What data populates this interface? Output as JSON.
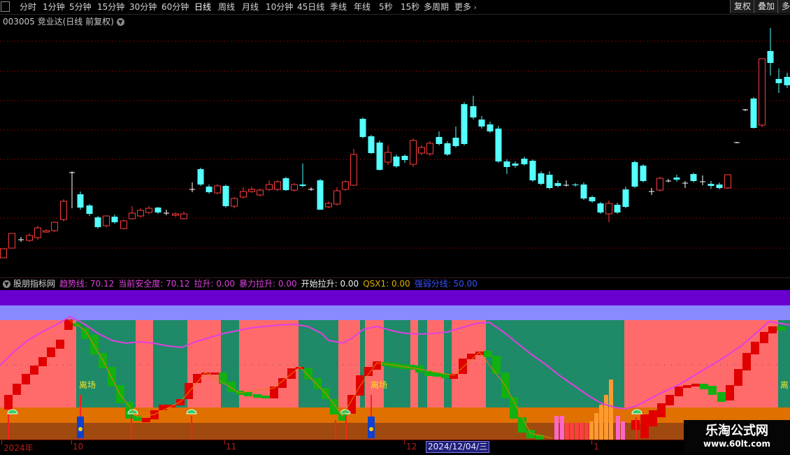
{
  "toolbar": {
    "periods": [
      "分时",
      "1分钟",
      "5分钟",
      "15分钟",
      "30分钟",
      "60分钟",
      "日线",
      "周线",
      "月线",
      "10分钟",
      "45日线",
      "季线",
      "年线",
      "5秒",
      "15秒",
      "多周期",
      "更多"
    ],
    "active_period": "日线",
    "right_buttons": [
      "复权",
      "叠加",
      "多"
    ]
  },
  "stock": {
    "label": "003005 竞业达(日线 前复权)"
  },
  "indicator": {
    "name": "股朋指标网",
    "readouts": [
      {
        "text": "趋势线: 70.12",
        "color": "#e040e0"
      },
      {
        "text": "当前安全度: 70.12",
        "color": "#e040e0"
      },
      {
        "text": "拉升: 0.00",
        "color": "#e040e0"
      },
      {
        "text": "暴力拉升: 0.00",
        "color": "#e040e0"
      },
      {
        "text": "开始拉升: 0.00",
        "color": "#f0f0f0"
      },
      {
        "text": "QSX1: 0.00",
        "color": "#e0b000"
      },
      {
        "text": "强弱分线: 50.00",
        "color": "#3a50ff"
      }
    ],
    "signals": [
      {
        "text": "离场"
      },
      {
        "text": "离场"
      },
      {
        "text": "离"
      }
    ]
  },
  "date_axis": {
    "labels": [
      "2024年",
      "10",
      "11",
      "12",
      "1"
    ],
    "cursor_date": "2024/12/04/三"
  },
  "watermark": {
    "title": "乐淘公式网",
    "url": "www.60lt.com"
  },
  "colors": {
    "up": "#ff3c3c",
    "down": "#54ffff",
    "grid": "#7a0000",
    "trend": "#e040e0"
  }
}
